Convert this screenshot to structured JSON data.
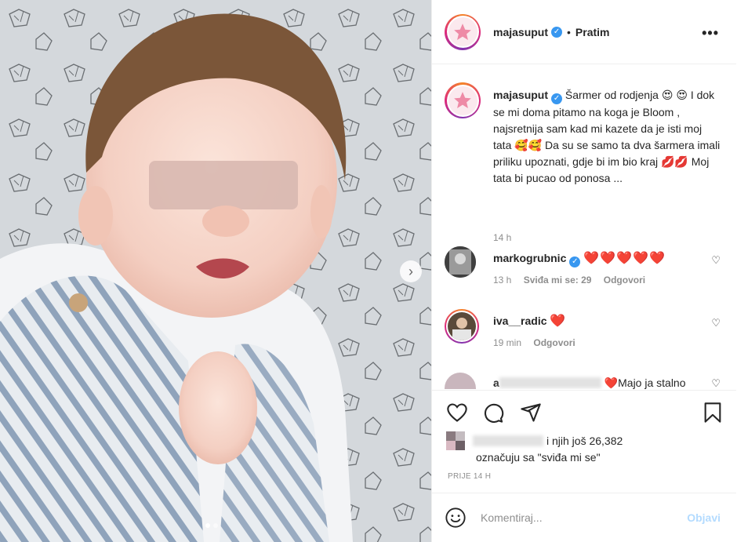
{
  "post": {
    "username": "majasuput",
    "follow_separator": "•",
    "follow_label": "Pratim",
    "more_icon": "more-horizontal-icon"
  },
  "caption": {
    "username": "majasuput",
    "text": "Šarmer od rodjenja 😍 😍 I dok se mi doma pitamo na koga je Bloom , najsretnija sam kad mi kazete da je isti moj tata 🥰🥰 Da su se samo ta dva šarmera imali priliku upoznati, gdje bi im bio kraj 💋💋 Moj tata bi pucao od ponosa ...",
    "time": "14 h"
  },
  "comments": [
    {
      "username": "markogrubnic",
      "verified": true,
      "text": "❤️❤️❤️❤️❤️",
      "time": "13 h",
      "likes": "Sviđa mi se: 29",
      "reply": "Odgovori"
    },
    {
      "username": "iva__radic",
      "verified": false,
      "text": "❤️",
      "time": "19 min",
      "reply": "Odgovori"
    },
    {
      "username": "a",
      "verified": false,
      "text": "❤️Majo ja stalno"
    }
  ],
  "likes": {
    "count_text": "i njih još 26,382",
    "label": "označuju sa \"sviđa mi se\""
  },
  "date": "PRIJE 14 H",
  "comment_box": {
    "placeholder": "Komentiraj...",
    "post_label": "Objavi"
  },
  "colors": {
    "accent": "#3897f0",
    "heart": "#ed1c3c",
    "post_disabled": "#b3dbff",
    "secondary_text": "#8e8e8e"
  },
  "carousel": {
    "current": 1,
    "total": 2
  }
}
